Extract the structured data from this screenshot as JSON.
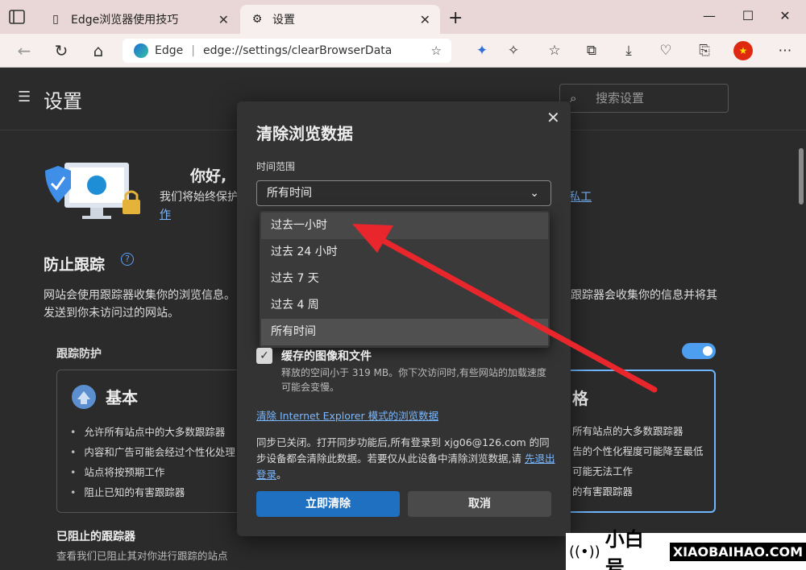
{
  "tabs": [
    {
      "title": "Edge浏览器使用技巧",
      "icon": "page-icon"
    },
    {
      "title": "设置",
      "icon": "gear-icon"
    }
  ],
  "address": {
    "site_label": "Edge",
    "url": "edge://settings/clearBrowserData"
  },
  "settings": {
    "title": "设置",
    "search_placeholder": "搜索设置",
    "hello": "你好,",
    "hello_sub": "我们将始终保护",
    "privacy_link": "私工",
    "privacy_link_cont": "作",
    "section_title": "防止跟踪",
    "desc_left": "网站会使用跟踪器收集你的浏览信息。发送到你未访问过的网站。",
    "desc_right": "跟踪器会收集你的信息并将其",
    "tracking_protection": "跟踪防护",
    "basic": {
      "title": "基本",
      "items": [
        "允许所有站点中的大多数跟踪器",
        "内容和广告可能会经过个性化处理",
        "站点将按预期工作",
        "阻止已知的有害跟踪器"
      ]
    },
    "strict": {
      "title": "格",
      "items": [
        "所有站点的大多数跟踪器",
        "告的个性化程度可能降至最低",
        "可能无法工作",
        "的有害跟踪器"
      ]
    },
    "blocked_title": "已阻止的跟踪器",
    "blocked_sub": "查看我们已阻止其对你进行跟踪的站点"
  },
  "dialog": {
    "title": "清除浏览数据",
    "range_label": "时间范围",
    "range_value": "所有时间",
    "options": [
      "过去一小时",
      "过去 24 小时",
      "过去 7 天",
      "过去 4 周",
      "所有时间"
    ],
    "cache_label": "缓存的图像和文件",
    "cache_desc": "释放的空间小于 319 MB。你下次访问时,有些网站的加载速度可能会变慢。",
    "ie_link": "清除 Internet Explorer 模式的浏览数据",
    "sync_note": "同步已关闭。打开同步功能后,所有登录到 xjg06@126.com 的同步设备都会清除此数据。若要仅从此设备中清除浏览数据,请 ",
    "sync_link": "先退出登录",
    "sync_end": "。",
    "clear_button": "立即清除",
    "cancel_button": "取消"
  },
  "brand": {
    "name": "小白号",
    "url": "XIAOBAIHAO.COM"
  },
  "colors": {
    "accent": "#1f70c1",
    "arrow": "#e8262c",
    "tabbar": "#e9d6d6"
  }
}
